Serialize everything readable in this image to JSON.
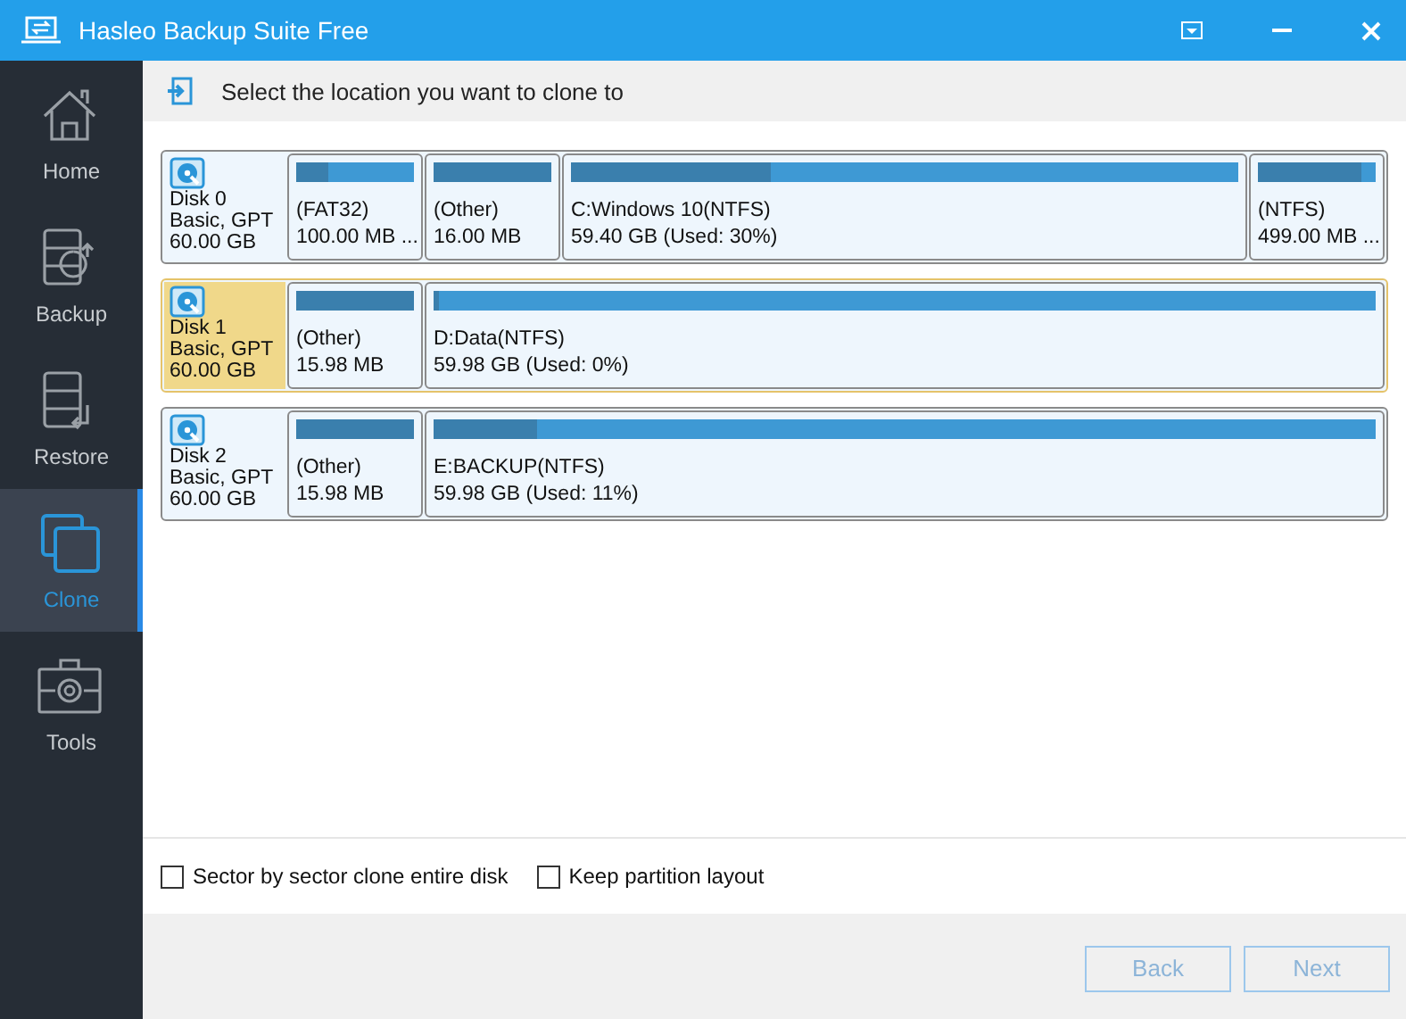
{
  "window": {
    "title": "Hasleo Backup Suite Free"
  },
  "sidebar": {
    "items": [
      {
        "label": "Home",
        "kind": "home",
        "selected": false
      },
      {
        "label": "Backup",
        "kind": "backup",
        "selected": false
      },
      {
        "label": "Restore",
        "kind": "restore",
        "selected": false
      },
      {
        "label": "Clone",
        "kind": "clone",
        "selected": true
      },
      {
        "label": "Tools",
        "kind": "tools",
        "selected": false
      }
    ]
  },
  "header": {
    "title": "Select the location you want to clone to"
  },
  "disks": [
    {
      "name": "Disk 0",
      "type": "Basic, GPT",
      "size": "60.00 GB",
      "selected": false,
      "partitions": [
        {
          "kind": "minor",
          "label": "(FAT32)",
          "detail": "100.00 MB ...",
          "level": 0.28
        },
        {
          "kind": "minor",
          "label": "(Other)",
          "detail": "16.00 MB",
          "level": 1
        },
        {
          "kind": "main",
          "label": "C:Windows 10(NTFS)",
          "detail": "59.40 GB (Used: 30%)",
          "level": 0.3
        },
        {
          "kind": "minor",
          "label": "(NTFS)",
          "detail": "499.00 MB ...",
          "level": 0.88
        }
      ]
    },
    {
      "name": "Disk 1",
      "type": "Basic, GPT",
      "size": "60.00 GB",
      "selected": true,
      "partitions": [
        {
          "kind": "minor",
          "label": "(Other)",
          "detail": "15.98 MB",
          "level": 1
        },
        {
          "kind": "main",
          "label": "D:Data(NTFS)",
          "detail": "59.98 GB (Used: 0%)",
          "level": 0.005
        }
      ]
    },
    {
      "name": "Disk 2",
      "type": "Basic, GPT",
      "size": "60.00 GB",
      "selected": false,
      "partitions": [
        {
          "kind": "minor",
          "label": "(Other)",
          "detail": "15.98 MB",
          "level": 1
        },
        {
          "kind": "main",
          "label": "E:BACKUP(NTFS)",
          "detail": "59.98 GB (Used: 11%)",
          "level": 0.11
        }
      ]
    }
  ],
  "options": [
    {
      "label": "Sector by sector clone entire disk",
      "checked": false
    },
    {
      "label": "Keep partition layout",
      "checked": false
    }
  ],
  "buttons": [
    {
      "label": "Back",
      "disabled": true
    },
    {
      "label": "Next",
      "disabled": true
    }
  ]
}
